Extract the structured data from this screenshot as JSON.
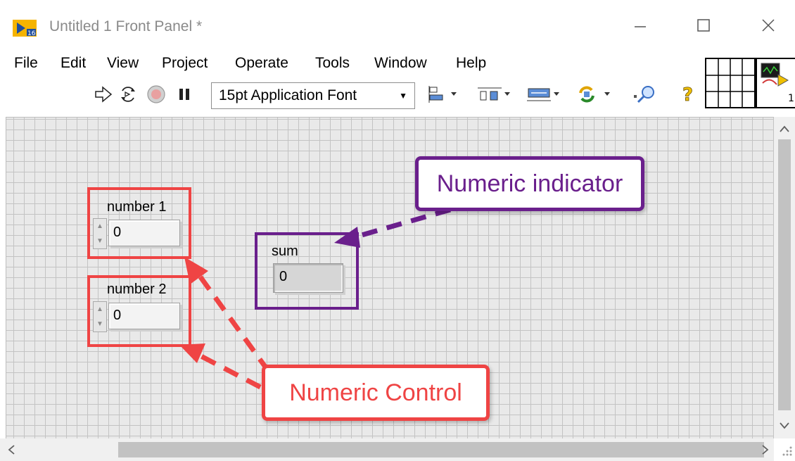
{
  "window": {
    "title": "Untitled 1 Front Panel *",
    "controls": {
      "minimize": "minimize-icon",
      "maximize": "maximize-icon",
      "close": "close-icon"
    }
  },
  "menu": [
    "File",
    "Edit",
    "View",
    "Project",
    "Operate",
    "Tools",
    "Window",
    "Help"
  ],
  "toolbar": {
    "run": "run-arrow-icon",
    "run_continuously": "run-continuously-icon",
    "abort": "abort-icon",
    "pause": "pause-icon",
    "font": "15pt Application Font",
    "align": "align-objects-icon",
    "distribute": "distribute-objects-icon",
    "resize": "resize-objects-icon",
    "reorder": "reorder-icon",
    "search": "search-icon",
    "help": "help-icon"
  },
  "panel": {
    "controls": [
      {
        "label": "number 1",
        "value": "0"
      },
      {
        "label": "number 2",
        "value": "0"
      }
    ],
    "indicator": {
      "label": "sum",
      "value": "0"
    }
  },
  "annotations": {
    "indicator_callout": "Numeric indicator",
    "control_callout": "Numeric Control"
  },
  "colors": {
    "annotation_red": "#ef4444",
    "annotation_purple": "#6a1f8c",
    "grid_bg": "#e9e9e9",
    "grid_line": "#c3c3c3"
  }
}
